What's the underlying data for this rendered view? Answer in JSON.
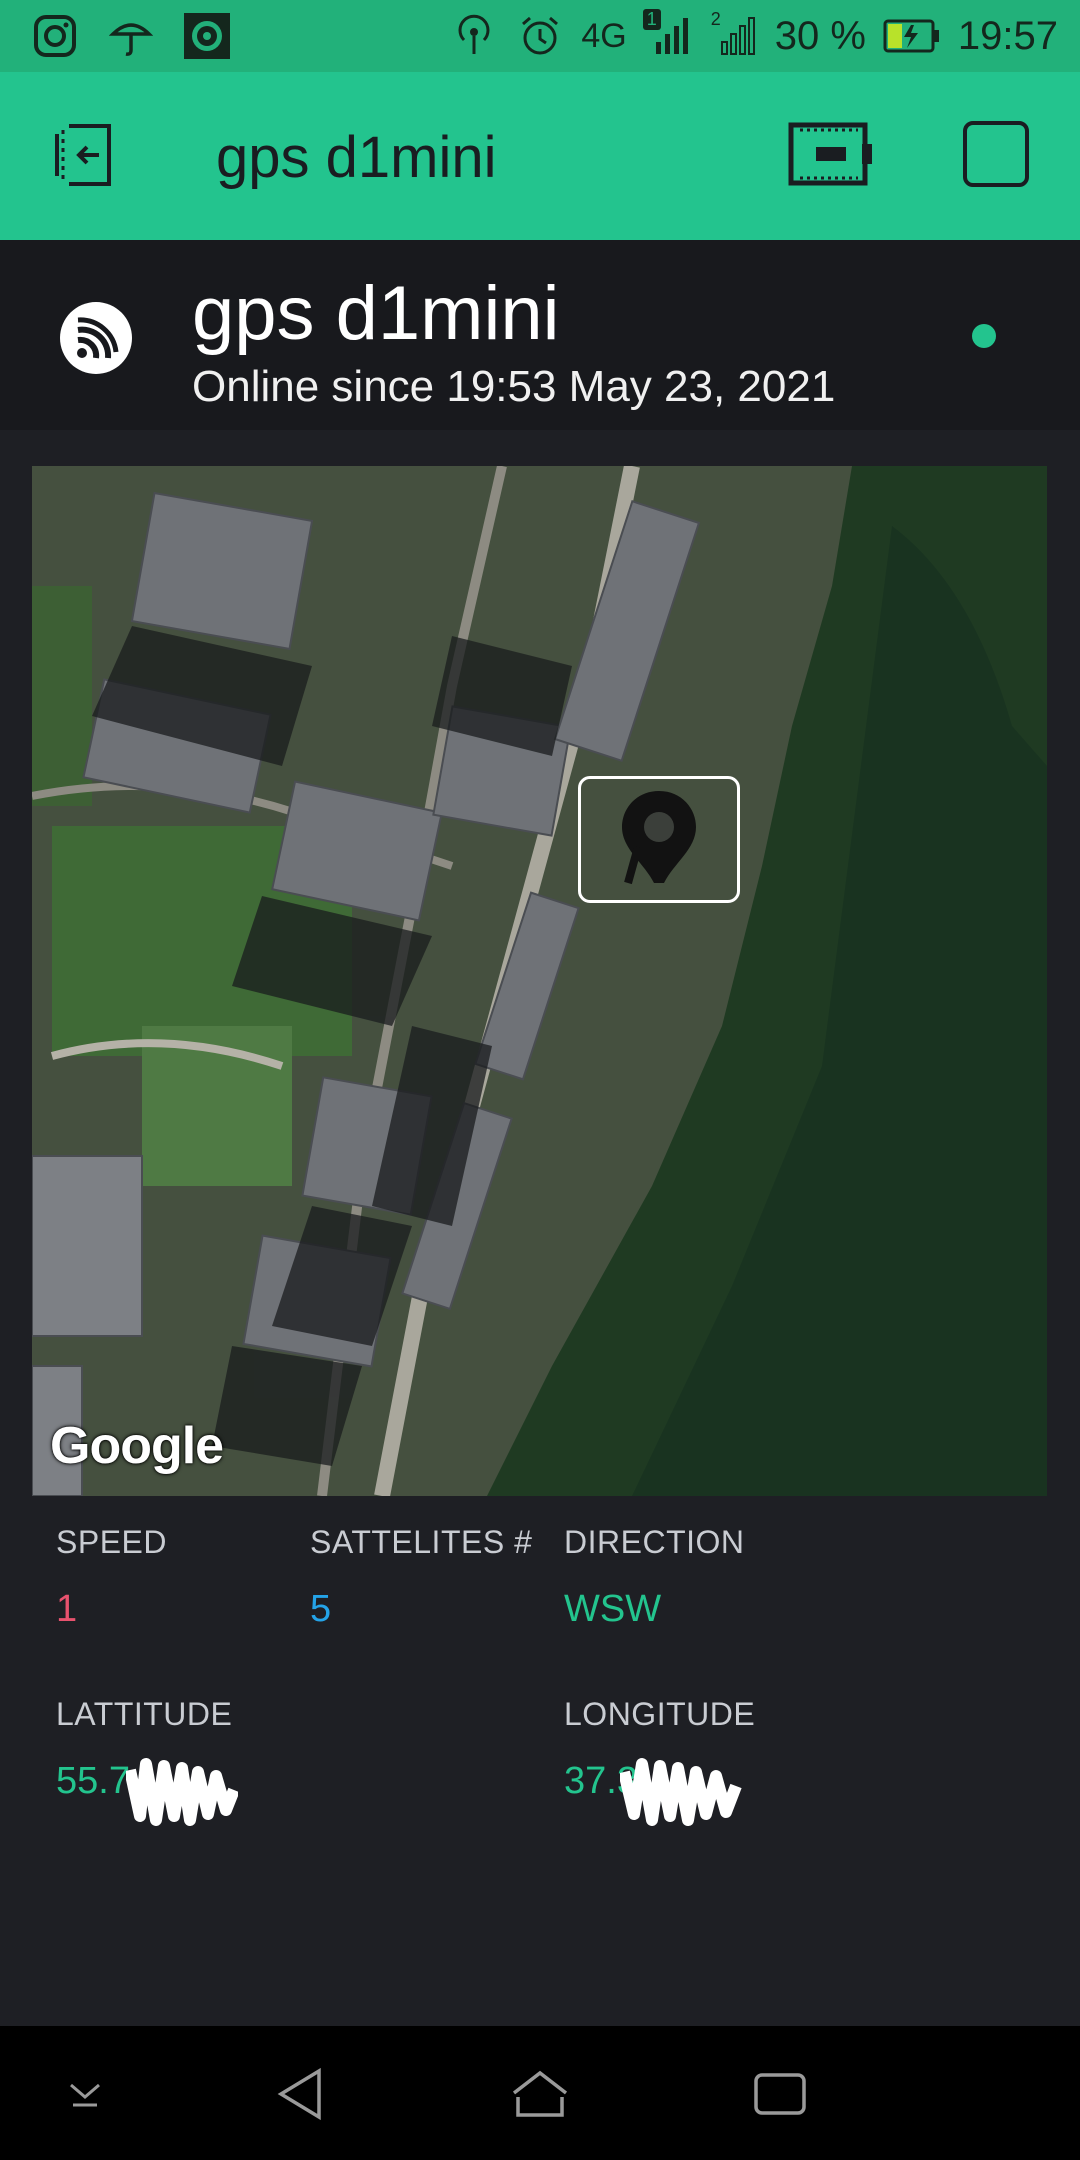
{
  "status_bar": {
    "network": "4G",
    "sim1": "1",
    "sim2": "2",
    "battery": "30 %",
    "time": "19:57",
    "icons": [
      "instagram-icon",
      "umbrella-icon",
      "camera-app-icon",
      "hotspot-icon",
      "alarm-icon",
      "signal-icon",
      "battery-charging-icon"
    ]
  },
  "app_header": {
    "title": "gps d1mini",
    "icons": [
      "back-to-projects-icon",
      "device-board-icon",
      "stop-square-icon"
    ],
    "color": "#23c48e"
  },
  "device": {
    "name": "gps d1mini",
    "status": "Online since 19:53 May 23, 2021",
    "status_color": "#23c48e",
    "icon": "esp-wifi-logo-icon"
  },
  "map": {
    "attribution": "Google",
    "marker_icon": "map-pin-icon"
  },
  "fields": {
    "speed": {
      "label": "SPEED",
      "value": "1",
      "color": "#e8526e"
    },
    "satellites": {
      "label": "SATTELITES #",
      "value": "5",
      "color": "#24a3e8"
    },
    "direction": {
      "label": "DIRECTION",
      "value": "WSW",
      "color": "#23c48e"
    },
    "latitude": {
      "label": "LATTITUDE",
      "value": "55.7",
      "color": "#23c48e"
    },
    "longitude": {
      "label": "LONGITUDE",
      "value": "37.3",
      "color": "#23c48e"
    }
  },
  "nav_bar": {
    "icons": [
      "notification-down-icon",
      "back-icon",
      "home-icon",
      "recents-icon"
    ]
  }
}
